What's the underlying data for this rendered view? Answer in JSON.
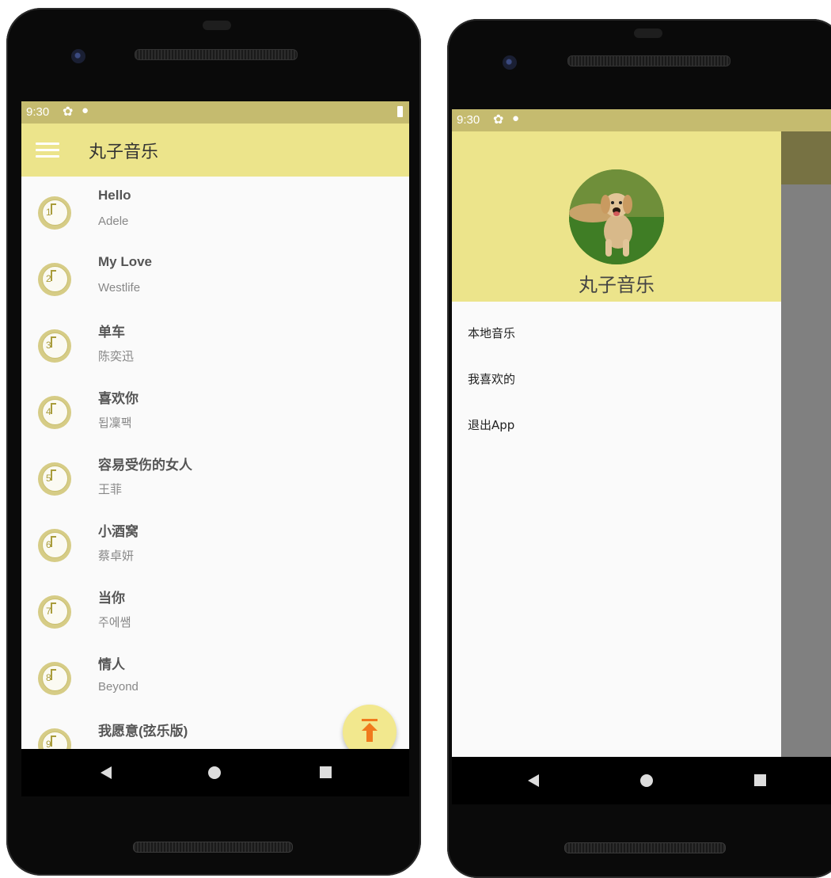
{
  "status_bar": {
    "time": "9:30",
    "gear_icon": "gear-icon",
    "android_icon": "android-icon",
    "battery_icon": "battery-icon"
  },
  "app": {
    "title": "丸子音乐",
    "menu_icon": "hamburger-menu-icon",
    "accent": "#ece48b",
    "status_color": "#c5bb6f"
  },
  "songs": [
    {
      "num": "1",
      "name": "Hello",
      "artist": "Adele"
    },
    {
      "num": "2",
      "name": "My Love",
      "artist": "Westlife"
    },
    {
      "num": "3",
      "name": "单车",
      "artist": "陈奕迅"
    },
    {
      "num": "4",
      "name": "喜欢你",
      "artist": "됩凜팩"
    },
    {
      "num": "5",
      "name": "容易受伤的女人",
      "artist": "王菲"
    },
    {
      "num": "6",
      "name": "小酒窝",
      "artist": "蔡卓妍"
    },
    {
      "num": "7",
      "name": "当你",
      "artist": "주에쌤"
    },
    {
      "num": "8",
      "name": "情人",
      "artist": "Beyond"
    },
    {
      "num": "9",
      "name": "我愿意(弦乐版)",
      "artist": ""
    }
  ],
  "fab": {
    "icon": "scroll-to-top-icon",
    "color": "#f2e88e",
    "icon_color": "#f07a1c"
  },
  "drawer": {
    "title": "丸子音乐",
    "avatar": "dog-avatar",
    "items": [
      {
        "label": "本地音乐"
      },
      {
        "label": "我喜欢的"
      },
      {
        "label": "退出App"
      }
    ]
  },
  "navbar": {
    "back_icon": "back-icon",
    "home_icon": "home-icon",
    "recents_icon": "recents-icon"
  }
}
